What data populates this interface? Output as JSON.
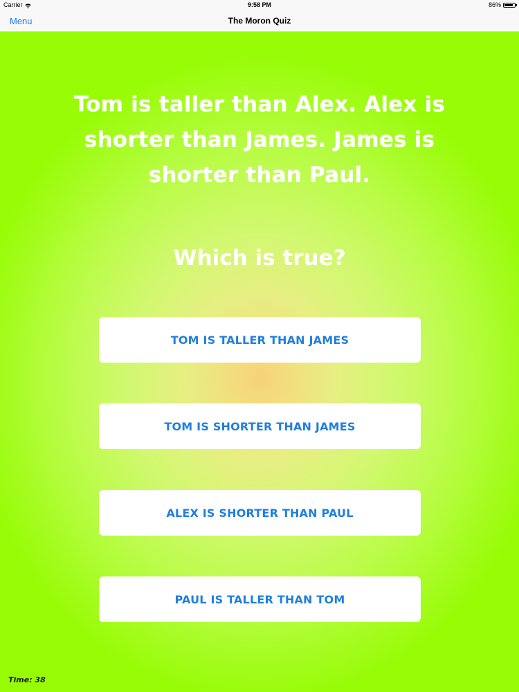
{
  "status_bar": {
    "carrier": "Carrier",
    "time": "9:58 PM",
    "battery_percent": "86%",
    "icons": [
      "wifi-icon",
      "battery-icon"
    ]
  },
  "nav_bar": {
    "menu_label": "Menu",
    "title": "The Moron Quiz"
  },
  "quiz": {
    "question": "Tom is taller than Alex. Alex is shorter than James. James is shorter than Paul.",
    "prompt": "Which is true?",
    "answers": [
      "TOM IS TALLER THAN JAMES",
      "TOM IS SHORTER THAN JAMES",
      "ALEX IS SHORTER THAN PAUL",
      "PAUL IS TALLER THAN TOM"
    ],
    "timer": "Time: 38"
  },
  "colors": {
    "accent": "#1f7fe0",
    "nav_link": "#1a7cf0",
    "background_outer": "#97fc05",
    "background_center": "#f6d27a",
    "text_light": "#ffffff"
  }
}
